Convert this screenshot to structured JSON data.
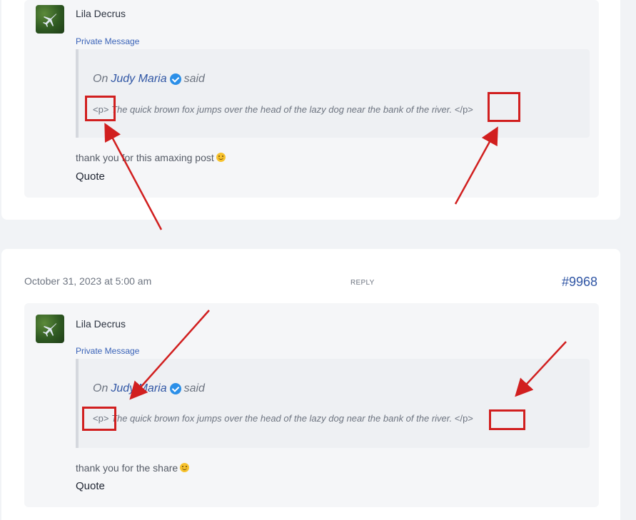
{
  "posts": [
    {
      "author": "Lila Decrus",
      "private_message": "Private Message",
      "quote_prefix": "On",
      "quoted_author": "Judy Maria",
      "said": "said",
      "quote_open_tag": "<p>",
      "quote_body": "The quick brown fox jumps over the head of the lazy dog near the bank of the river.",
      "quote_close_tag": "</p>",
      "comment": "thank you for this amaxing post",
      "quote_button": "Quote"
    },
    {
      "date": "October 31, 2023 at 5:00 am",
      "reply": "REPLY",
      "post_number": "#9968",
      "author": "Lila Decrus",
      "private_message": "Private Message",
      "quote_prefix": "On",
      "quoted_author": "Judy Maria",
      "said": "said",
      "quote_open_tag": "<p>",
      "quote_body": "The quick brown fox jumps over the head of the lazy dog near the bank of the river.",
      "quote_close_tag": "</p>",
      "comment": "thank you for the share",
      "quote_button": "Quote"
    }
  ],
  "icons": {
    "avatar": "airplane-avatar-icon",
    "verified": "verified-check-icon",
    "emoji": "slightly-smiling-face-icon"
  },
  "colors": {
    "annotation": "#d11f1f",
    "link": "#2f55a4",
    "verified": "#2b8fe8"
  }
}
